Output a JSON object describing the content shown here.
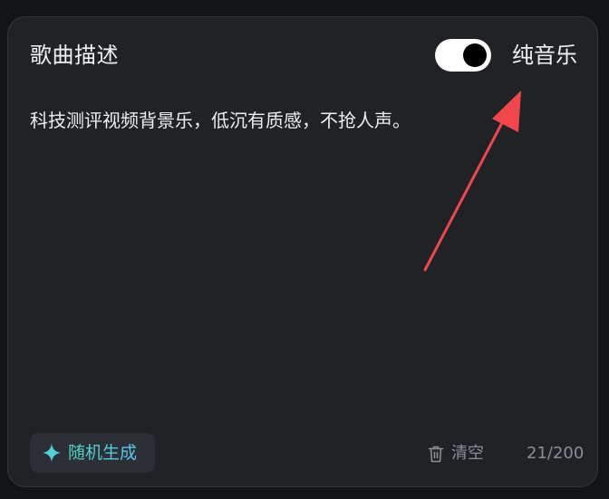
{
  "panel": {
    "title": "歌曲描述",
    "toggle": {
      "label": "纯音乐",
      "state": "on"
    },
    "description": "科技测评视频背景乐，低沉有质感，不抢人声。",
    "random_button": {
      "label": "随机生成",
      "icon": "sparkle-icon"
    },
    "clear_button": {
      "label": "清空",
      "icon": "trash-icon"
    },
    "char_counter": "21/200"
  },
  "colors": {
    "background": "#121417",
    "card": "#202226",
    "text": "#f2f3f5",
    "muted": "#8a8e96",
    "annotation_arrow": "#f0474d",
    "accent_gradient_start": "#4fd6c0",
    "accent_gradient_end": "#58c7f0"
  }
}
